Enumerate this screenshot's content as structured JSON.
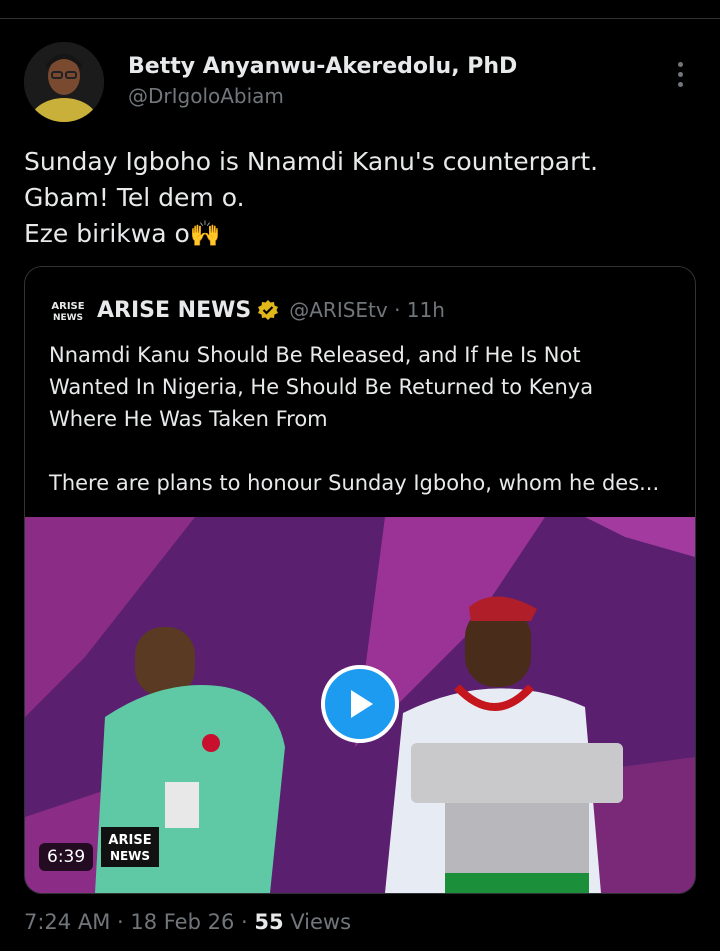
{
  "author": {
    "name": "Betty Anyanwu-Akeredolu, PhD",
    "handle": "@DrIgoloAbiam"
  },
  "tweet_text": {
    "line1": "Sunday Igboho is Nnamdi Kanu's counterpart.",
    "line2": "Gbam! Tel dem o.",
    "line3": "Eze birikwa o🙌"
  },
  "quote": {
    "name": "ARISE NEWS",
    "handle_time": "@ARISEtv · 11h",
    "logo_text": "ARISE NEWS",
    "text_line1": "Nnamdi Kanu Should Be Released, and If He Is Not",
    "text_line2": "Wanted In Nigeria, He Should Be Returned to Kenya",
    "text_line3": "Where He Was Taken From",
    "text_line4": "There are plans to honour Sunday Igboho, whom he des...",
    "video_duration": "6:39",
    "video_watermark": "ARISE NEWS"
  },
  "footer": {
    "time_date": "7:24 AM · 18 Feb 26 · ",
    "views_count": "55",
    "views_label": " Views"
  },
  "colors": {
    "background": "#000000",
    "text": "#e7e9ea",
    "muted": "#71767b",
    "accent": "#1d9bf0",
    "verified": "#e2b719",
    "video_purple": "#5a1f6e"
  }
}
